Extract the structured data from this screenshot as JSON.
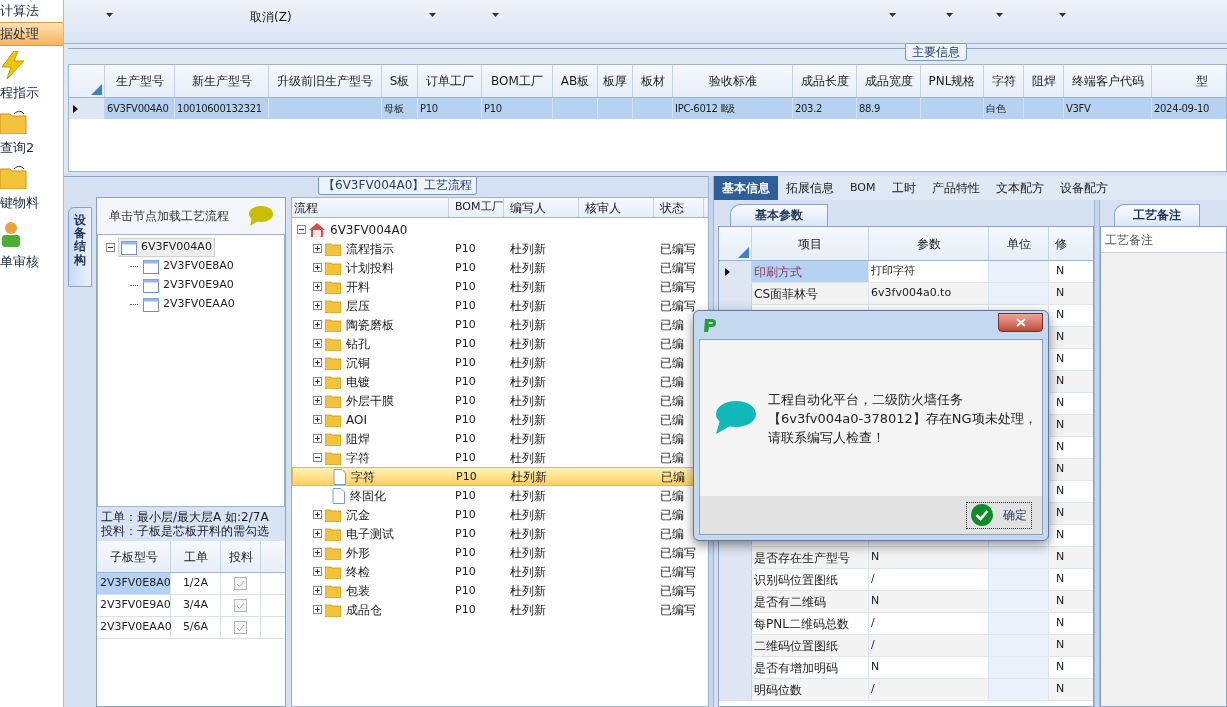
{
  "sidebar": {
    "items": [
      {
        "label": "计算法",
        "selected": false
      },
      {
        "label": "据处理",
        "selected": true
      },
      {
        "label": "程指示",
        "kind": "bolt",
        "selected": false
      },
      {
        "label": "查询2",
        "kind": "folder",
        "selected": false
      },
      {
        "label": "键物料",
        "kind": "folder",
        "selected": false
      },
      {
        "label": "单审核",
        "kind": "person",
        "selected": false
      }
    ]
  },
  "toolbar": {
    "items": [
      {
        "label": "取消(Z)"
      }
    ]
  },
  "main_info": {
    "title": "主要信息",
    "columns": [
      "生产型号",
      "新生产型号",
      "升级前旧生产型号",
      "S板",
      "订单工厂",
      "BOM工厂",
      "AB板",
      "板厚",
      "板材",
      "验收标准",
      "成品长度",
      "成品宽度",
      "PNL规格",
      "字符",
      "阻焊",
      "终端客户代码",
      "型"
    ],
    "rows": [
      {
        "selected": true,
        "cells": [
          "6V3FV004A0",
          "10010600132321",
          null,
          "母板",
          "P10",
          "P10",
          null,
          null,
          null,
          "IPC-6012 Ⅱ级",
          "203.2",
          "88.9",
          null,
          "白色",
          null,
          "V3FV",
          "2024-09-10"
        ]
      }
    ]
  },
  "process_group": {
    "title": "【6V3FV004A0】工艺流程"
  },
  "device_panel": {
    "tab": "设备结构",
    "header": "单击节点加载工艺流程",
    "tree": [
      {
        "label": "6V3FV004A0",
        "selected": true,
        "expanded": true,
        "children": [
          {
            "label": "2V3FV0E8A0",
            "selected": false
          },
          {
            "label": "2V3FV0E9A0",
            "selected": false
          },
          {
            "label": "2V3FV0EAA0",
            "selected": false
          }
        ]
      }
    ],
    "hint": [
      "工单：最小层/最大层A 如:2/7A",
      "投料：子板是芯板开料的需勾选"
    ],
    "sub_columns": [
      "子板型号",
      "工单",
      "投料"
    ],
    "sub_rows": [
      {
        "board": "2V3FV0E8A0",
        "order": "1/2A",
        "checked": true,
        "selected": true
      },
      {
        "board": "2V3FV0E9A0",
        "order": "3/4A",
        "checked": true,
        "selected": false
      },
      {
        "board": "2V3FV0EAA0",
        "order": "5/6A",
        "checked": true,
        "selected": false
      }
    ]
  },
  "flow": {
    "columns": [
      "流程",
      "BOM工厂",
      "编写人",
      "核审人",
      "状态"
    ],
    "tree": [
      {
        "label": "6V3FV004A0",
        "kind": "root",
        "expanded": true,
        "selected": false,
        "children": [
          {
            "label": "流程指示",
            "kind": "folder",
            "expanded": false,
            "selected": false,
            "bom": "P10",
            "author": "杜列新",
            "status": "已编写"
          },
          {
            "label": "计划投料",
            "kind": "folder",
            "expanded": false,
            "selected": false,
            "bom": "P10",
            "author": "杜列新",
            "status": "已编写"
          },
          {
            "label": "开料",
            "kind": "folder",
            "expanded": false,
            "selected": false,
            "bom": "P10",
            "author": "杜列新",
            "status": "已编写"
          },
          {
            "label": "层压",
            "kind": "folder",
            "expanded": false,
            "selected": false,
            "bom": "P10",
            "author": "杜列新",
            "status": "已编写"
          },
          {
            "label": "陶瓷磨板",
            "kind": "folder",
            "expanded": false,
            "selected": false,
            "bom": "P10",
            "author": "杜列新",
            "status": "已编"
          },
          {
            "label": "钻孔",
            "kind": "folder",
            "expanded": false,
            "selected": false,
            "bom": "P10",
            "author": "杜列新",
            "status": "已编"
          },
          {
            "label": "沉铜",
            "kind": "folder",
            "expanded": false,
            "selected": false,
            "bom": "P10",
            "author": "杜列新",
            "status": "已编"
          },
          {
            "label": "电镀",
            "kind": "folder",
            "expanded": false,
            "selected": false,
            "bom": "P10",
            "author": "杜列新",
            "status": "已编"
          },
          {
            "label": "外层干膜",
            "kind": "folder",
            "expanded": false,
            "selected": false,
            "bom": "P10",
            "author": "杜列新",
            "status": "已编"
          },
          {
            "label": "AOI",
            "kind": "folder",
            "expanded": false,
            "selected": false,
            "bom": "P10",
            "author": "杜列新",
            "status": "已编"
          },
          {
            "label": "阻焊",
            "kind": "folder",
            "expanded": false,
            "selected": false,
            "bom": "P10",
            "author": "杜列新",
            "status": "已编"
          },
          {
            "label": "字符",
            "kind": "folder",
            "expanded": true,
            "selected": false,
            "bom": "P10",
            "author": "杜列新",
            "status": "已编",
            "children": [
              {
                "label": "字符",
                "kind": "file",
                "selected": true,
                "bom": "P10",
                "author": "杜列新",
                "status": "已编"
              },
              {
                "label": "终固化",
                "kind": "file",
                "selected": false,
                "bom": "P10",
                "author": "杜列新",
                "status": "已编"
              }
            ]
          },
          {
            "label": "沉金",
            "kind": "folder",
            "expanded": false,
            "selected": false,
            "bom": "P10",
            "author": "杜列新",
            "status": "已编"
          },
          {
            "label": "电子测试",
            "kind": "folder",
            "expanded": false,
            "selected": false,
            "bom": "P10",
            "author": "杜列新",
            "status": "已编"
          },
          {
            "label": "外形",
            "kind": "folder",
            "expanded": false,
            "selected": false,
            "bom": "P10",
            "author": "杜列新",
            "status": "已编写"
          },
          {
            "label": "终检",
            "kind": "folder",
            "expanded": false,
            "selected": false,
            "bom": "P10",
            "author": "杜列新",
            "status": "已编写"
          },
          {
            "label": "包装",
            "kind": "folder",
            "expanded": false,
            "selected": false,
            "bom": "P10",
            "author": "杜列新",
            "status": "已编写"
          },
          {
            "label": "成品仓",
            "kind": "folder",
            "expanded": false,
            "selected": false,
            "bom": "P10",
            "author": "杜列新",
            "status": "已编写"
          }
        ]
      }
    ]
  },
  "detail_tabs": [
    {
      "label": "基本信息",
      "selected": true
    },
    {
      "label": "拓展信息",
      "selected": false
    },
    {
      "label": "BOM",
      "selected": false
    },
    {
      "label": "工时",
      "selected": false
    },
    {
      "label": "产品特性",
      "selected": false
    },
    {
      "label": "文本配方",
      "selected": false
    },
    {
      "label": "设备配方",
      "selected": false
    }
  ],
  "params": {
    "tab": "基本参数",
    "columns": [
      "项目",
      "参数",
      "单位",
      "修"
    ],
    "rows": [
      {
        "item": "印刷方式",
        "param": "打印字符",
        "modified": "N",
        "selected": true
      },
      {
        "item": "CS面菲林号",
        "param": "6v3fv004a0.to",
        "modified": "N",
        "selected": false
      },
      {
        "modified": "N"
      },
      {
        "modified": "N"
      },
      {
        "modified": "N"
      },
      {
        "modified": "N"
      },
      {
        "modified": "N"
      },
      {
        "modified": "N"
      },
      {
        "modified": "N"
      },
      {
        "modified": "N"
      },
      {
        "modified": "N"
      },
      {
        "modified": "N"
      },
      {
        "modified": "N"
      },
      {
        "item": "是否存在生产型号",
        "param": "N",
        "modified": "N",
        "selected": false
      },
      {
        "item": "识别码位置图纸",
        "param": "/",
        "modified": "N",
        "selected": false
      },
      {
        "item": "是否有二维码",
        "param": "N",
        "modified": "N",
        "selected": false
      },
      {
        "item": "每PNL二维码总数",
        "param": "/",
        "modified": "N",
        "selected": false
      },
      {
        "item": "二维码位置图纸",
        "param": "/",
        "modified": "N",
        "selected": false
      },
      {
        "item": "是否有增加明码",
        "param": "N",
        "modified": "N",
        "selected": false
      },
      {
        "item": "明码位数",
        "param": "/",
        "modified": "N",
        "selected": false
      }
    ]
  },
  "notes": {
    "tab": "工艺备注",
    "header": "工艺备注"
  },
  "dialog": {
    "lines": [
      "工程自动化平台，二级防火墙任务",
      "【6v3fv004a0-378012】存在NG项未处理，",
      "请联系编写人检查！"
    ],
    "ok": "确定"
  }
}
